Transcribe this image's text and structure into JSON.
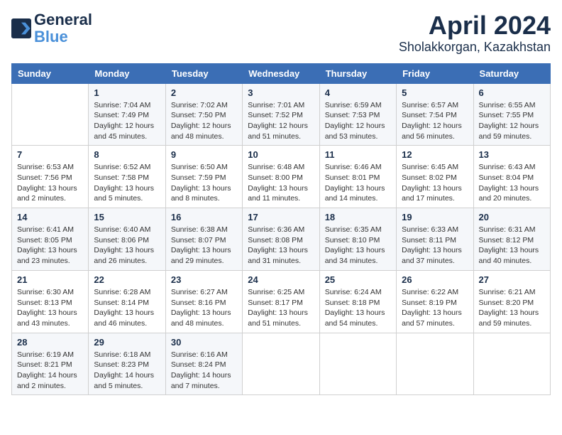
{
  "header": {
    "logo_line1": "General",
    "logo_line2": "Blue",
    "month": "April 2024",
    "location": "Sholakkorgan, Kazakhstan"
  },
  "weekdays": [
    "Sunday",
    "Monday",
    "Tuesday",
    "Wednesday",
    "Thursday",
    "Friday",
    "Saturday"
  ],
  "weeks": [
    [
      null,
      {
        "day": 1,
        "sunrise": "7:04 AM",
        "sunset": "7:49 PM",
        "daylight": "12 hours and 45 minutes."
      },
      {
        "day": 2,
        "sunrise": "7:02 AM",
        "sunset": "7:50 PM",
        "daylight": "12 hours and 48 minutes."
      },
      {
        "day": 3,
        "sunrise": "7:01 AM",
        "sunset": "7:52 PM",
        "daylight": "12 hours and 51 minutes."
      },
      {
        "day": 4,
        "sunrise": "6:59 AM",
        "sunset": "7:53 PM",
        "daylight": "12 hours and 53 minutes."
      },
      {
        "day": 5,
        "sunrise": "6:57 AM",
        "sunset": "7:54 PM",
        "daylight": "12 hours and 56 minutes."
      },
      {
        "day": 6,
        "sunrise": "6:55 AM",
        "sunset": "7:55 PM",
        "daylight": "12 hours and 59 minutes."
      }
    ],
    [
      {
        "day": 7,
        "sunrise": "6:53 AM",
        "sunset": "7:56 PM",
        "daylight": "13 hours and 2 minutes."
      },
      {
        "day": 8,
        "sunrise": "6:52 AM",
        "sunset": "7:58 PM",
        "daylight": "13 hours and 5 minutes."
      },
      {
        "day": 9,
        "sunrise": "6:50 AM",
        "sunset": "7:59 PM",
        "daylight": "13 hours and 8 minutes."
      },
      {
        "day": 10,
        "sunrise": "6:48 AM",
        "sunset": "8:00 PM",
        "daylight": "13 hours and 11 minutes."
      },
      {
        "day": 11,
        "sunrise": "6:46 AM",
        "sunset": "8:01 PM",
        "daylight": "13 hours and 14 minutes."
      },
      {
        "day": 12,
        "sunrise": "6:45 AM",
        "sunset": "8:02 PM",
        "daylight": "13 hours and 17 minutes."
      },
      {
        "day": 13,
        "sunrise": "6:43 AM",
        "sunset": "8:04 PM",
        "daylight": "13 hours and 20 minutes."
      }
    ],
    [
      {
        "day": 14,
        "sunrise": "6:41 AM",
        "sunset": "8:05 PM",
        "daylight": "13 hours and 23 minutes."
      },
      {
        "day": 15,
        "sunrise": "6:40 AM",
        "sunset": "8:06 PM",
        "daylight": "13 hours and 26 minutes."
      },
      {
        "day": 16,
        "sunrise": "6:38 AM",
        "sunset": "8:07 PM",
        "daylight": "13 hours and 29 minutes."
      },
      {
        "day": 17,
        "sunrise": "6:36 AM",
        "sunset": "8:08 PM",
        "daylight": "13 hours and 31 minutes."
      },
      {
        "day": 18,
        "sunrise": "6:35 AM",
        "sunset": "8:10 PM",
        "daylight": "13 hours and 34 minutes."
      },
      {
        "day": 19,
        "sunrise": "6:33 AM",
        "sunset": "8:11 PM",
        "daylight": "13 hours and 37 minutes."
      },
      {
        "day": 20,
        "sunrise": "6:31 AM",
        "sunset": "8:12 PM",
        "daylight": "13 hours and 40 minutes."
      }
    ],
    [
      {
        "day": 21,
        "sunrise": "6:30 AM",
        "sunset": "8:13 PM",
        "daylight": "13 hours and 43 minutes."
      },
      {
        "day": 22,
        "sunrise": "6:28 AM",
        "sunset": "8:14 PM",
        "daylight": "13 hours and 46 minutes."
      },
      {
        "day": 23,
        "sunrise": "6:27 AM",
        "sunset": "8:16 PM",
        "daylight": "13 hours and 48 minutes."
      },
      {
        "day": 24,
        "sunrise": "6:25 AM",
        "sunset": "8:17 PM",
        "daylight": "13 hours and 51 minutes."
      },
      {
        "day": 25,
        "sunrise": "6:24 AM",
        "sunset": "8:18 PM",
        "daylight": "13 hours and 54 minutes."
      },
      {
        "day": 26,
        "sunrise": "6:22 AM",
        "sunset": "8:19 PM",
        "daylight": "13 hours and 57 minutes."
      },
      {
        "day": 27,
        "sunrise": "6:21 AM",
        "sunset": "8:20 PM",
        "daylight": "13 hours and 59 minutes."
      }
    ],
    [
      {
        "day": 28,
        "sunrise": "6:19 AM",
        "sunset": "8:21 PM",
        "daylight": "14 hours and 2 minutes."
      },
      {
        "day": 29,
        "sunrise": "6:18 AM",
        "sunset": "8:23 PM",
        "daylight": "14 hours and 5 minutes."
      },
      {
        "day": 30,
        "sunrise": "6:16 AM",
        "sunset": "8:24 PM",
        "daylight": "14 hours and 7 minutes."
      },
      null,
      null,
      null,
      null
    ]
  ]
}
